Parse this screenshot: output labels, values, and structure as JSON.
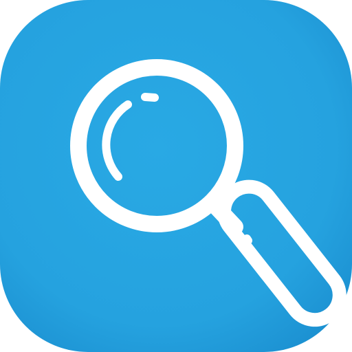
{
  "icon": {
    "name": "magnifying-glass-icon",
    "colors": {
      "tile_center": "#29A9E4",
      "tile_edge": "#1B8FD0",
      "glyph": "#FFFFFF"
    }
  }
}
